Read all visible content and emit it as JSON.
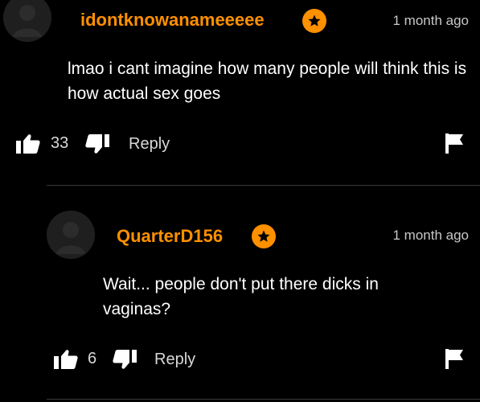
{
  "comments": [
    {
      "username": "idontknowanameeeee",
      "timestamp": "1 month ago",
      "text": "lmao i cant imagine how many people will think this is how actual sex goes",
      "votes": "33",
      "reply_label": "Reply",
      "badge_icon": "star-icon"
    },
    {
      "username": "QuarterD156",
      "timestamp": "1 month ago",
      "text": "Wait... people don't put there dicks in vaginas?",
      "votes": "6",
      "reply_label": "Reply",
      "badge_icon": "star-icon"
    }
  ],
  "colors": {
    "background": "#000000",
    "accent": "#ff9000",
    "text": "#ffffff",
    "muted": "#c8c8c8",
    "avatar": "#1f1f1f",
    "divider": "#3a3a3a"
  }
}
